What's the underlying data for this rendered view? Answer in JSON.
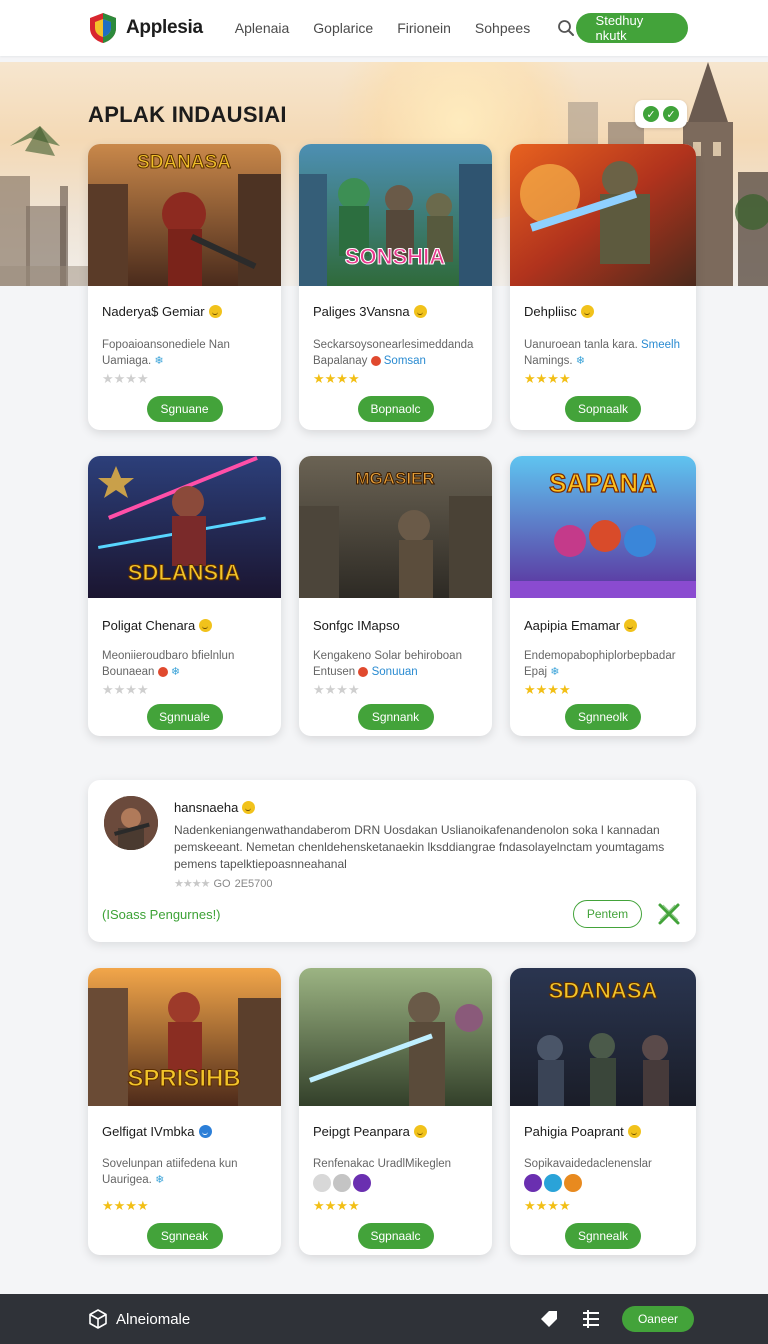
{
  "header": {
    "brand": "Applesia",
    "nav": [
      "Aplenaia",
      "Goplarice",
      "Firionein",
      "Sohpees"
    ],
    "cta": "Stedhuy nkutk"
  },
  "hero": {
    "title": "APLAK INDAUSIAI"
  },
  "cards": [
    {
      "title": "Naderya$ Gemiar",
      "desc": "Fopoaioansonediele Nan Uamiaga.",
      "stars": 0,
      "button": "Sgnuane",
      "img_text": "SDANASA"
    },
    {
      "title": "Paliges 3Vansna",
      "desc": "Seckarsoysonearlesimeddanda Bapalanay",
      "desc_link": "Somsan",
      "stars": 4,
      "button": "Bopnaolc",
      "img_text": "SONSHIA"
    },
    {
      "title": "Dehpliisc",
      "desc": "Uanuroean tanla kara.",
      "desc_link": "Smeelh",
      "desc2": "Namings.",
      "stars": 4,
      "button": "Sopnaalk"
    },
    {
      "title": "Poligat Chenara",
      "desc": "Meoniieroudbaro bfielnlun Bounaean",
      "stars": 0,
      "button": "Sgnnuale",
      "img_text": "SDLANSIA"
    },
    {
      "title": "Sonfgc IMapso",
      "desc": "Kengakeno Solar behiroboan Entusen",
      "desc_link": "Sonuuan",
      "stars": 0,
      "button": "Sgnnank",
      "img_text": "MGASIER"
    },
    {
      "title": "Aapipia Emamar",
      "desc": "Endemopabophiplorbepbadar Epaj",
      "stars": 4,
      "button": "Sgnneolk",
      "img_text": "SAPANA"
    },
    {
      "title": "Gelfigat IVmbka",
      "desc": "Sovelunpan atiifedena kun Uaurigea.",
      "stars": 4,
      "button": "Sgnneak",
      "img_text": "SPRISIHB"
    },
    {
      "title": "Peipgt Peanpara",
      "desc": "Renfenakac UradlMikeglen",
      "stars": 4,
      "button": "Sgpnaalc"
    },
    {
      "title": "Pahigia Poaprant",
      "desc": "Sopikavaidedaclenenslar",
      "stars": 4,
      "button": "Sgnnealk",
      "img_text": "SDANASA"
    }
  ],
  "review": {
    "name": "hansnaeha",
    "body": "Nadenkeniangenwathandaberom DRN Uosdakan Uslianoikafenandenolon soka l kannadan pemskeeant. Nemetan chenldehensketanaekin lksddiangrae fndasolayelnctam youmtagams pemens tapelktiepoasnneahanal",
    "rating_text": "GO",
    "count": "2E5700",
    "link": "(ISoass Pengurnes!)",
    "button": "Pentem"
  },
  "footer": {
    "brand": "Alneiomale",
    "button": "Oaneer"
  },
  "colors": {
    "accent": "#43a33a",
    "footer_bg": "#2f3238",
    "star": "#f2bf16"
  }
}
